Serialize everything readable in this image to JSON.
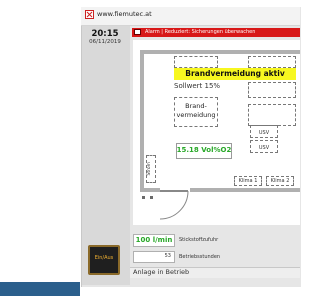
{
  "window": {
    "title": "www.fiemutec.at"
  },
  "sidebar": {
    "time": "20:15",
    "date": "06/11/2019",
    "einaus_button": "Ein/Aus"
  },
  "alarm": {
    "text": "Alarm | Reduziert: Sicherungen überwachen"
  },
  "plan": {
    "banner": "Brandvermeidung aktiv",
    "sollwert": "Sollwert 15%",
    "brand_label_1": "Brand-",
    "brand_label_2": "vermeidung",
    "gas_value": "15.18 Vol%O2",
    "usv_1": "USV",
    "usv_2": "USV",
    "strom": "Strom",
    "klima_1": "Klima 1",
    "klima_2": "Klima 2"
  },
  "readouts": {
    "flow_value": "100 l/min",
    "flow_label": "Stickstoffzufuhr",
    "hours_value": "53",
    "hours_label": "Betriebsstunden"
  },
  "status": {
    "text": "Anlage in Betrieb"
  },
  "colors": {
    "alarm": "#d81818",
    "banner_yellow": "#f7f720",
    "value_green": "#28a828",
    "button_accent": "#f0b030"
  },
  "icons": {
    "app": "fiemutec-logo-icon"
  }
}
